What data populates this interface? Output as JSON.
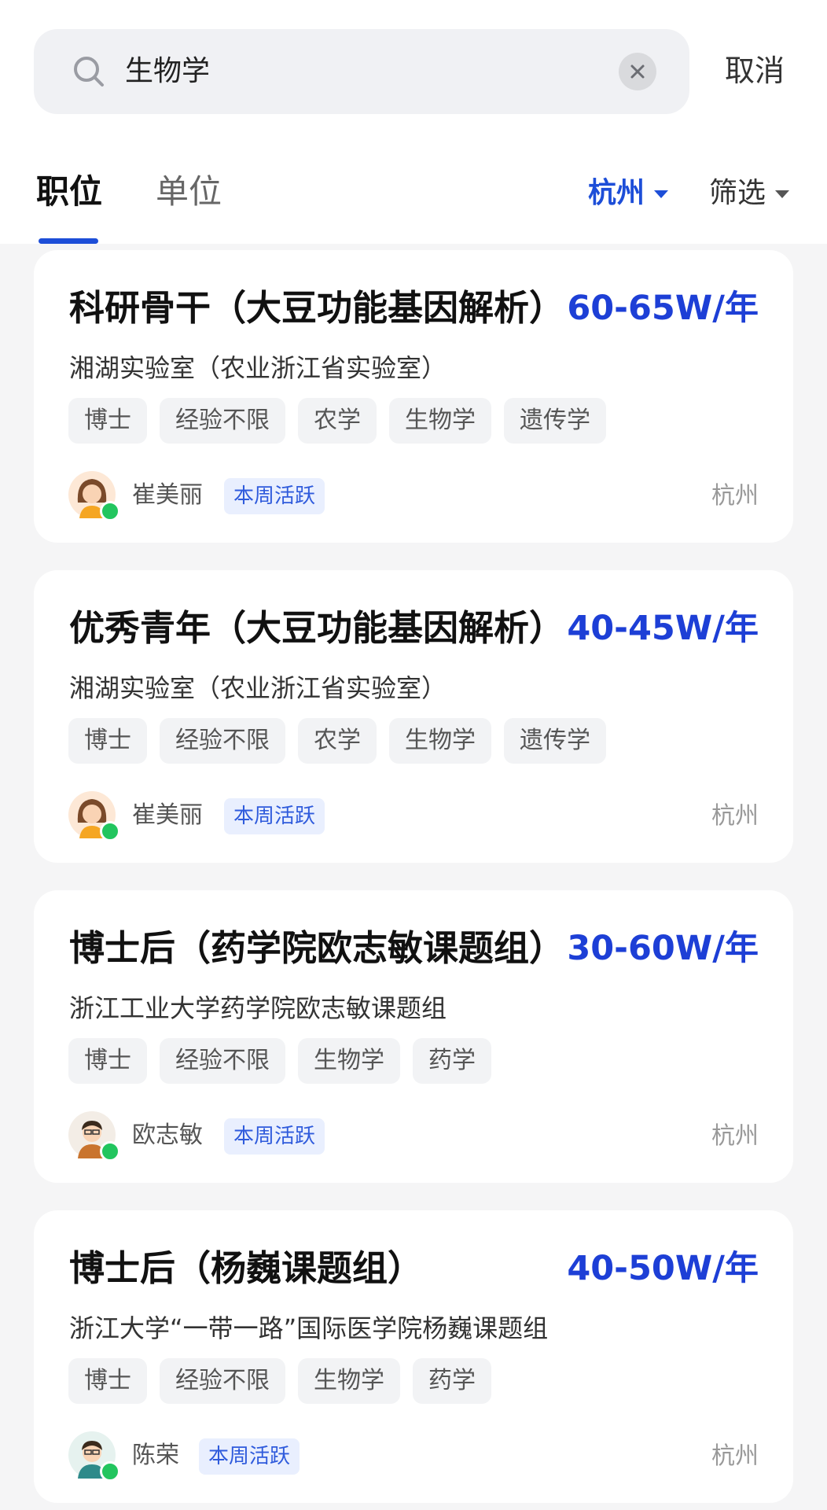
{
  "search": {
    "query": "生物学",
    "cancel_label": "取消"
  },
  "tabs": [
    {
      "label": "职位",
      "active": true
    },
    {
      "label": "单位",
      "active": false
    }
  ],
  "filters": {
    "city": "杭州",
    "more": "筛选"
  },
  "colors": {
    "accent": "#1d4ed8",
    "salary": "#1d3fd6",
    "online": "#22c55e"
  },
  "jobs": [
    {
      "title": "科研骨干（大豆功能基因解析）",
      "salary": "60-65W/年",
      "org": "湘湖实验室（农业浙江省实验室）",
      "tags": [
        "博士",
        "经验不限",
        "农学",
        "生物学",
        "遗传学"
      ],
      "recruiter": "崔美丽",
      "badge": "本周活跃",
      "city": "杭州"
    },
    {
      "title": "优秀青年（大豆功能基因解析）",
      "salary": "40-45W/年",
      "org": "湘湖实验室（农业浙江省实验室）",
      "tags": [
        "博士",
        "经验不限",
        "农学",
        "生物学",
        "遗传学"
      ],
      "recruiter": "崔美丽",
      "badge": "本周活跃",
      "city": "杭州"
    },
    {
      "title": "博士后（药学院欧志敏课题组）",
      "salary": "30-60W/年",
      "org": "浙江工业大学药学院欧志敏课题组",
      "tags": [
        "博士",
        "经验不限",
        "生物学",
        "药学"
      ],
      "recruiter": "欧志敏",
      "badge": "本周活跃",
      "city": "杭州"
    },
    {
      "title": "博士后（杨巍课题组）",
      "salary": "40-50W/年",
      "org": "浙江大学“一带一路”国际医学院杨巍课题组",
      "tags": [
        "博士",
        "经验不限",
        "生物学",
        "药学"
      ],
      "recruiter": "陈荣",
      "badge": "本周活跃",
      "city": "杭州"
    }
  ]
}
